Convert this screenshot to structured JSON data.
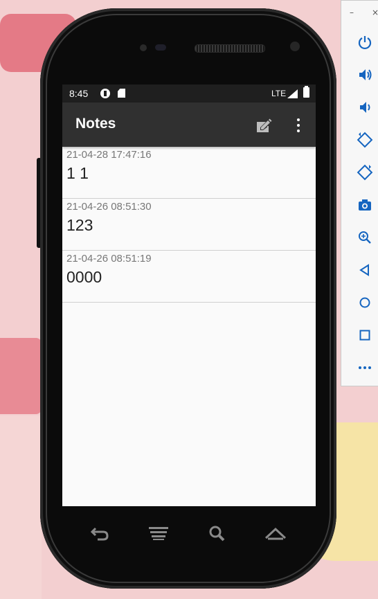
{
  "status_bar": {
    "time": "8:45",
    "network": "LTE"
  },
  "app_bar": {
    "title": "Notes",
    "icons": [
      "edit-note-icon",
      "more-vert-icon"
    ]
  },
  "notes": [
    {
      "date": "21-04-28 17:47:16",
      "text": "1 1"
    },
    {
      "date": "21-04-26 08:51:30",
      "text": "123"
    },
    {
      "date": "21-04-26 08:51:19",
      "text": "0000"
    }
  ],
  "nav_bar": [
    "back-icon",
    "menu-icon",
    "search-icon",
    "home-icon"
  ],
  "emulator_toolbar": {
    "window_controls": {
      "minimize": "–",
      "close": "×"
    },
    "buttons": [
      "power-icon",
      "volume-up-icon",
      "volume-down-icon",
      "rotate-left-icon",
      "rotate-right-icon",
      "camera-icon",
      "zoom-icon",
      "back-triangle-icon",
      "home-circle-icon",
      "overview-square-icon",
      "more-icon"
    ]
  },
  "colors": {
    "appbar": "#303030",
    "statusbar": "#1f1f1f",
    "accent": "#1565c0",
    "background": "#f3cfd0"
  }
}
